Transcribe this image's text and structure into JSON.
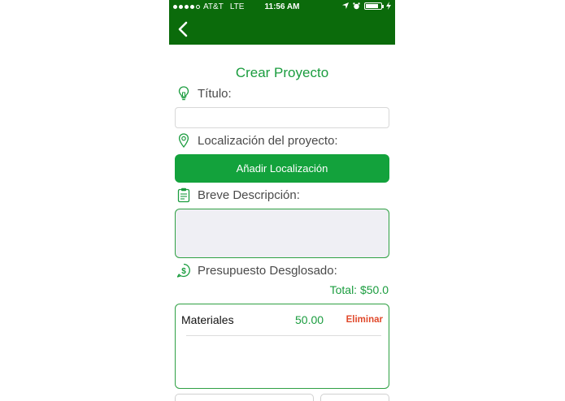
{
  "status_bar": {
    "carrier": "AT&T",
    "network": "LTE",
    "time": "11:56 AM",
    "battery_level": 0.85
  },
  "nav": {
    "back_icon": "chevron-left-icon"
  },
  "form": {
    "title": "Crear Proyecto",
    "titulo_label": "Título:",
    "titulo_value": "",
    "location_label": "Localización del proyecto:",
    "add_location_button": "Añadir Localización",
    "description_label": "Breve Descripción:",
    "description_value": "",
    "budget_label": "Presupuesto Desglosado:",
    "total": "Total: $50.0"
  },
  "budget_items": [
    {
      "name": "Materiales",
      "amount": "50.00",
      "delete_label": "Eliminar"
    }
  ],
  "colors": {
    "nav_green": "#0b6b0b",
    "accent_green": "#13a23c",
    "delete_red": "#e0492b"
  }
}
